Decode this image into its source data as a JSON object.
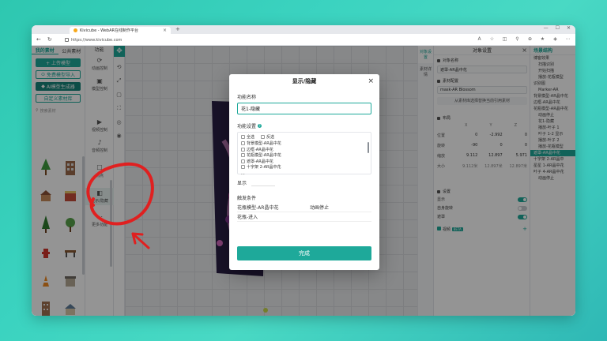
{
  "browser": {
    "tab_title": "Kivicube - WebAR在线制作平台",
    "tab_close": "×",
    "new_tab": "+",
    "url": "https://www.kivicube.com"
  },
  "left_panel": {
    "tab_my": "我的素材",
    "tab_public": "公共素材",
    "upload_button": "+ 上传模型",
    "free_import_button": "免费模型导入",
    "ai_button": "AI模型生成器",
    "custom_button": "自定义素材库",
    "search_placeholder": "搜索素材"
  },
  "function_col": {
    "header": "功能",
    "items": [
      {
        "label": "动画控制",
        "icon": "⟳"
      },
      {
        "label": "模型控制",
        "icon": "▣"
      },
      {
        "label": "视频控制",
        "icon": "▶"
      },
      {
        "label": "音频控制",
        "icon": "♪"
      },
      {
        "label": "热点",
        "icon": "☐"
      },
      {
        "label": "显示/隐藏",
        "icon": "◧"
      },
      {
        "label": "更多功能",
        "icon": "⋯"
      }
    ]
  },
  "modal": {
    "title": "显示/隐藏",
    "close": "×",
    "name_label": "功能名称",
    "name_value": "花1-隐藏",
    "settings_label": "功能设置",
    "select_all": "全选",
    "invert": "反选",
    "list_items": [
      "背景模型-AR晶中花",
      "边框-AR晶中花",
      "花瓶模型-AR晶中花",
      "遮罩-AR晶中花",
      "十字架 2-AR晶中花",
      "..."
    ],
    "display_label": "显示",
    "trigger_label": "触发条件",
    "trigger_rows": [
      {
        "object": "花瓶模型-AR晶中花",
        "event": "动画停止"
      },
      {
        "object": "花瓶-进入",
        "event": ""
      }
    ],
    "done_button": "完成"
  },
  "object_settings": {
    "side_tab_object": "对象设置",
    "side_tab_material": "素材详情",
    "header": "对象设置",
    "close": "×",
    "name_section": "对象名称",
    "name_value": "遮罩-AR晶中花",
    "material_section": "素材配置",
    "material_value": "mask-AR Blossom",
    "replace_link": "从素材库选择替换当前引用素材",
    "layout_section": "布局",
    "axes": [
      "X",
      "Y",
      "Z"
    ],
    "position": {
      "label": "位置",
      "x": "0",
      "y": "-2.992",
      "z": "0"
    },
    "rotation": {
      "label": "旋转",
      "x": "-90",
      "y": "0",
      "z": "0"
    },
    "scale": {
      "label": "缩放",
      "x": "9.112",
      "y": "12.897",
      "z": "5.971"
    },
    "size": {
      "label": "大小",
      "x": "9.112米",
      "y": "12.897米",
      "z": "12.897米"
    },
    "settings_section": "设置",
    "toggles": [
      {
        "label": "显示",
        "on": true
      },
      {
        "label": "自身旋转",
        "on": false
      },
      {
        "label": "遮罩",
        "on": true
      }
    ],
    "footer_label": "视频",
    "footer_badge": "BETA"
  },
  "scene_tree": {
    "header": "场景结构",
    "rows": [
      {
        "label": "博客效果",
        "indent": false,
        "selected": false
      },
      {
        "label": "扫描识别",
        "indent": true,
        "selected": false
      },
      {
        "label": "开始扫描",
        "indent": true,
        "selected": false
      },
      {
        "label": "播放-花瓶模型",
        "indent": true,
        "selected": false
      },
      {
        "label": "识别图",
        "indent": false,
        "selected": false
      },
      {
        "label": "Marker-AR",
        "indent": true,
        "selected": false
      },
      {
        "label": "背景模型-AR晶中花",
        "indent": false,
        "selected": false
      },
      {
        "label": "边框-AR晶中花",
        "indent": false,
        "selected": false
      },
      {
        "label": "花瓶模型-AR晶中花",
        "indent": false,
        "selected": false
      },
      {
        "label": "动画停止",
        "indent": true,
        "selected": false
      },
      {
        "label": "花1-隐藏",
        "indent": true,
        "selected": false
      },
      {
        "label": "播放-叶子 1",
        "indent": true,
        "selected": false
      },
      {
        "label": "叶子 1-2 显示",
        "indent": true,
        "selected": false
      },
      {
        "label": "播放-叶子 2",
        "indent": true,
        "selected": false
      },
      {
        "label": "播放-花瓶模型",
        "indent": true,
        "selected": false
      },
      {
        "label": "遮罩-AR晶中花",
        "indent": false,
        "selected": true
      },
      {
        "label": "十字架 2-AR晶中",
        "indent": false,
        "selected": false
      },
      {
        "label": "星星 1-AR晶中花",
        "indent": false,
        "selected": false
      },
      {
        "label": "叶子 4-AR晶中花",
        "indent": false,
        "selected": false
      },
      {
        "label": "动画停止",
        "indent": true,
        "selected": false
      }
    ]
  },
  "colors": {
    "accent": "#1ea99a",
    "annotation": "#e02020"
  }
}
